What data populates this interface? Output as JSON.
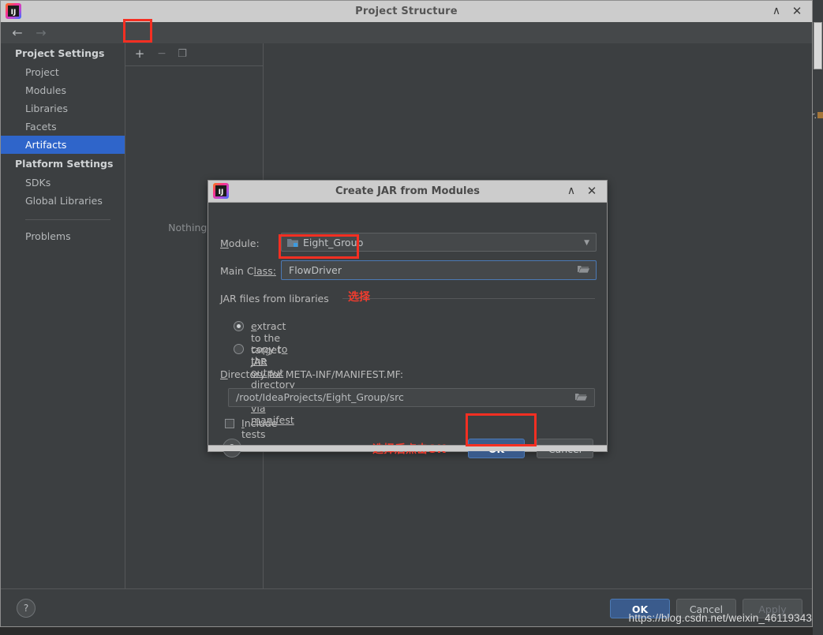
{
  "main_window": {
    "title": "Project Structure",
    "app_icon": "intellij-idea-icon",
    "titlebar_buttons": [
      {
        "name": "minimize",
        "glyph": "∧"
      },
      {
        "name": "close",
        "glyph": "✕"
      }
    ],
    "nav": {
      "back_glyph": "←",
      "forward_glyph": "→"
    },
    "sidebar": {
      "groups": [
        {
          "header": "Project Settings",
          "items": [
            {
              "label": "Project",
              "selected": false
            },
            {
              "label": "Modules",
              "selected": false
            },
            {
              "label": "Libraries",
              "selected": false
            },
            {
              "label": "Facets",
              "selected": false
            },
            {
              "label": "Artifacts",
              "selected": true
            }
          ]
        },
        {
          "header": "Platform Settings",
          "items": [
            {
              "label": "SDKs",
              "selected": false
            },
            {
              "label": "Global Libraries",
              "selected": false
            }
          ]
        }
      ],
      "footer_item": "Problems"
    },
    "artifacts_panel": {
      "toolbar": [
        {
          "name": "add",
          "glyph": "+"
        },
        {
          "name": "remove",
          "glyph": "−"
        },
        {
          "name": "copy",
          "glyph": "❐"
        }
      ],
      "empty_text": "Nothing to"
    },
    "bottom_bar": {
      "help_glyph": "?",
      "buttons": [
        {
          "label": "OK",
          "style": "primary",
          "enabled": true
        },
        {
          "label": "Cancel",
          "style": "normal",
          "enabled": true
        },
        {
          "label": "Apply",
          "style": "disabled",
          "enabled": false
        }
      ]
    },
    "watermark": "https://blog.csdn.net/weixin_46119343"
  },
  "dialog": {
    "title": "Create JAR from Modules",
    "app_icon": "intellij-idea-icon",
    "titlebar_buttons": [
      {
        "name": "minimize",
        "glyph": "∧"
      },
      {
        "name": "close",
        "glyph": "✕"
      }
    ],
    "module": {
      "label_prefix": "M",
      "label_rest": "odule:",
      "icon": "module-folder-icon",
      "value": "Eight_Group",
      "arrow_glyph": "▼"
    },
    "main_class": {
      "label_prefix": "Main C",
      "label_rest": "lass:",
      "value": "FlowDriver",
      "browse_glyph": "📁"
    },
    "jar_group": {
      "label": "JAR files from libraries",
      "options": [
        {
          "label_prefix": "e",
          "label_rest": "xtract to the target JAR",
          "full_label": "extract to the target JAR",
          "selected": true
        },
        {
          "label_prefix": "copy t",
          "label_rest": "o the output directory and link via manifest",
          "full_label": "copy to the output directory and link via manifest",
          "selected": false
        }
      ]
    },
    "directory": {
      "label_prefix": "D",
      "label_rest": "irectory for META-INF/MANIFEST.MF:",
      "value": "/root/IdeaProjects/Eight_Group/src",
      "browse_glyph": "📁"
    },
    "include_tests": {
      "label_prefix": "I",
      "label_rest": "nclude tests",
      "checked": false
    },
    "help_glyph": "?",
    "ok_label": "OK",
    "cancel_label": "Cancel"
  },
  "annotations": {
    "color": "#f52f22",
    "select_note": "选择",
    "ok_note": "选择后点击OK",
    "boxes": [
      {
        "name": "add-artifact-button"
      },
      {
        "name": "main-class-field"
      },
      {
        "name": "dialog-ok-button"
      }
    ]
  },
  "background": {
    "right_fragment": "r."
  }
}
